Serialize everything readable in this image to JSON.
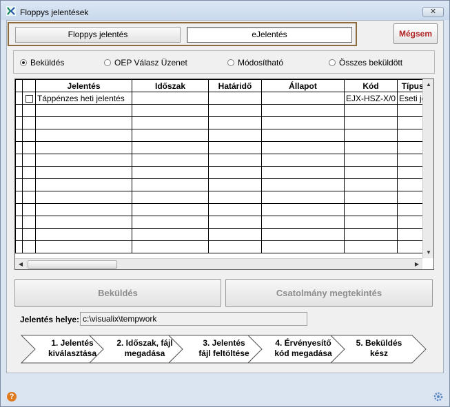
{
  "window": {
    "title": "Floppys jelentések",
    "close_glyph": "✕"
  },
  "tabs": {
    "floppy": "Floppys jelentés",
    "ejelentes": "eJelentés"
  },
  "cancel_label": "Mégsem",
  "radios": [
    {
      "label": "Beküldés",
      "checked": true
    },
    {
      "label": "OEP Válasz Üzenet",
      "checked": false
    },
    {
      "label": "Módosítható",
      "checked": false
    },
    {
      "label": "Összes beküldött",
      "checked": false
    }
  ],
  "table": {
    "headers": [
      "Jelentés",
      "Időszak",
      "Határidő",
      "Állapot",
      "Kód",
      "Típus"
    ],
    "rows": [
      {
        "jelentes": "Táppénzes heti jelentés",
        "idoszak": "",
        "hatarido": "",
        "allapot": "",
        "kod": "EJX-HSZ-X/0",
        "tipus": "Eseti je"
      }
    ]
  },
  "buttons": {
    "bekuldes": "Beküldés",
    "csatolmany": "Csatolmány megtekintés"
  },
  "path": {
    "label": "Jelentés helye:",
    "value": "c:\\visualix\\tempwork"
  },
  "wizard": [
    {
      "line1": "1. Jelentés",
      "line2": "kiválasztása"
    },
    {
      "line1": "2. Időszak, fájl",
      "line2": "megadása"
    },
    {
      "line1": "3. Jelentés",
      "line2": "fájl feltöltése"
    },
    {
      "line1": "4. Érvényesítő",
      "line2": "kód megadása"
    },
    {
      "line1": "5. Beküldés",
      "line2": "kész"
    }
  ],
  "colors": {
    "accent_red": "#b22222",
    "tab_border": "#8b6b3c",
    "help_orange": "#e07a1f"
  },
  "icons": {
    "app": "visualix-logo-icon",
    "help": "help-icon",
    "settings": "gear-icon"
  }
}
